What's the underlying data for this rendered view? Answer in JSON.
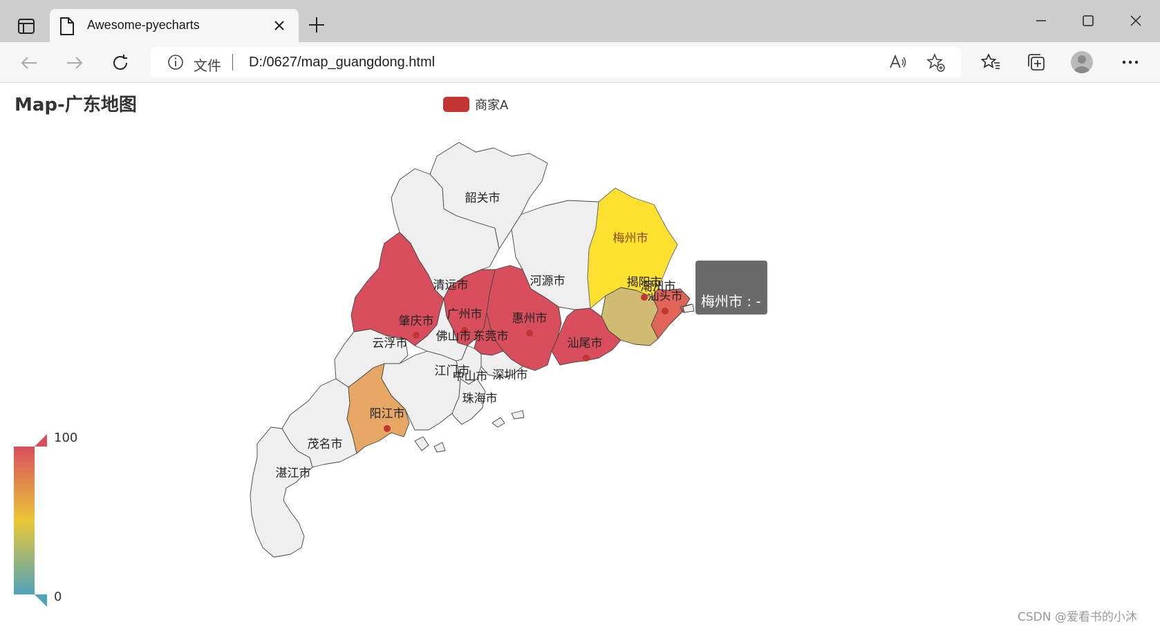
{
  "browser": {
    "tab_title": "Awesome-pyecharts",
    "address_prefix": "文件",
    "url": "D:/0627/map_guangdong.html"
  },
  "page": {
    "title": "Map-广东地图",
    "legend_label": "商家A",
    "legend_color": "#c23531"
  },
  "visual_map": {
    "max_label": "100",
    "min_label": "0",
    "colors": [
      "#d94e5d",
      "#eac736",
      "#50a3ba"
    ]
  },
  "tooltip": {
    "text": "梅州市 : -"
  },
  "watermark": "CSDN @爱看书的小沐",
  "chart_data": {
    "type": "map",
    "region": "广东",
    "series": [
      {
        "name": "商家A"
      }
    ],
    "regions": [
      {
        "name": "韶关市",
        "value": null
      },
      {
        "name": "清远市",
        "value": null
      },
      {
        "name": "河源市",
        "value": null
      },
      {
        "name": "梅州市",
        "value": null,
        "highlighted": true
      },
      {
        "name": "肇庆市",
        "value": 100
      },
      {
        "name": "广州市",
        "value": 100
      },
      {
        "name": "惠州市",
        "value": 100
      },
      {
        "name": "揭阳市",
        "value": 50
      },
      {
        "name": "潮州市",
        "value": null
      },
      {
        "name": "汕头市",
        "value": 90
      },
      {
        "name": "云浮市",
        "value": null
      },
      {
        "name": "佛山市",
        "value": null
      },
      {
        "name": "东莞市",
        "value": null
      },
      {
        "name": "汕尾市",
        "value": 100
      },
      {
        "name": "江门市",
        "value": null
      },
      {
        "name": "中山市",
        "value": null
      },
      {
        "name": "深圳市",
        "value": null
      },
      {
        "name": "珠海市",
        "value": null
      },
      {
        "name": "阳江市",
        "value": 75
      },
      {
        "name": "茂名市",
        "value": null
      },
      {
        "name": "湛江市",
        "value": null
      }
    ]
  }
}
